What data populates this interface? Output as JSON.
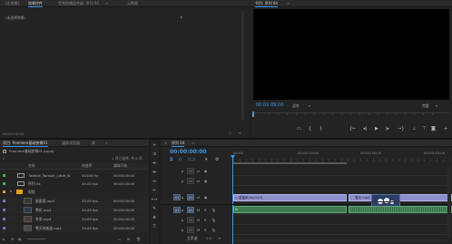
{
  "source_monitor": {
    "tabs": [
      "(无剪辑)",
      "效果控件",
      "音频剪辑混合器: 序列 04",
      "元数据"
    ],
    "clip_label": "(未选择剪辑)",
    "timecode": "00:00:00:00"
  },
  "program_monitor": {
    "tab": "节目: 序列 04",
    "timecode": "00:01:09:00",
    "fit": "适合",
    "quality": "完整"
  },
  "project": {
    "tabs": [
      "项目: Premiere基础剪辑01",
      "媒体浏览器",
      "库"
    ],
    "filename": "Premiere基础剪辑01.prproj",
    "selection_count": "1 项已选择, 共 6 项",
    "columns": [
      "名称",
      "帧速率",
      "媒体开始"
    ],
    "items": [
      {
        "name": "Twinkle_Twinkle_Little_St",
        "rate": "44100 Hz",
        "start": "00:00:00:00",
        "color": "#3dbb54",
        "kind": "audio"
      },
      {
        "name": "序列 04",
        "rate": "25.00 fps",
        "start": "00:00:00:00",
        "color": "#3dbb54",
        "kind": "sequence"
      },
      {
        "name": "视频",
        "rate": "",
        "start": "",
        "color": "#e6a21a",
        "kind": "folder"
      },
      {
        "name": "星星雨.mp4",
        "rate": "25.00 fps",
        "start": "00:00:00:00",
        "color": "#6b78c9",
        "kind": "video"
      },
      {
        "name": "雪花.mp4",
        "rate": "25.00 fps",
        "start": "00:00:00:00",
        "color": "#6b78c9",
        "kind": "video"
      },
      {
        "name": "冬季.mp4",
        "rate": "25.00 fps",
        "start": "00:00:00:00",
        "color": "#6b78c9",
        "kind": "video"
      },
      {
        "name": "雪天的街道.mp4",
        "rate": "25.00 fps",
        "start": "00:00:00:00",
        "color": "#6b78c9",
        "kind": "video"
      }
    ]
  },
  "timeline": {
    "tab": "序列 04",
    "timecode": "00:00:00:00",
    "ruler": [
      "00:00",
      "00:00:15:00",
      "00:00:30:00",
      "00:00:45:00"
    ],
    "tracks": [
      "V3",
      "V2",
      "V1",
      "A1",
      "A2",
      "A3"
    ],
    "master": "主声道",
    "master_value": "0.0",
    "clips": {
      "v1_a": "星星雨.mp4 [V]",
      "v1_b": "雪花.mp4",
      "a1": "fx"
    }
  },
  "tools": [
    "selection-tool",
    "track-select-tool",
    "ripple-edit-tool",
    "razor-tool",
    "slip-tool",
    "pen-tool",
    "hand-tool",
    "type-tool"
  ]
}
